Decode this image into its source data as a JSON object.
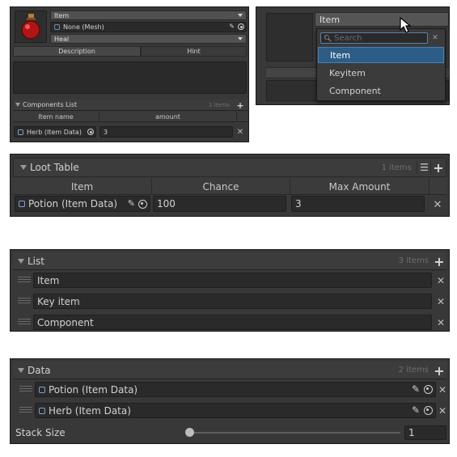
{
  "item_inspector": {
    "type_value": "Item",
    "mesh_value": "None (Mesh)",
    "effect_value": "Heal",
    "tabs": [
      "Description",
      "Hint"
    ],
    "components": {
      "title": "Components List",
      "count": "1 items",
      "headers": [
        "Item name",
        "amount"
      ],
      "row": {
        "item": "Herb (Item Data)",
        "amount": "3"
      }
    }
  },
  "dropdown": {
    "field_value": "Item",
    "search_placeholder": "Search",
    "options": [
      "Item",
      "Keyitem",
      "Component"
    ],
    "selected_index": 0
  },
  "loot_table": {
    "title": "Loot Table",
    "count": "1 items",
    "headers": [
      "Item",
      "Chance",
      "Max Amount"
    ],
    "row": {
      "item": "Potion (Item Data)",
      "chance": "100",
      "max_amount": "3"
    }
  },
  "list": {
    "title": "List",
    "count": "3 items",
    "items": [
      "Item",
      "Key item",
      "Component"
    ]
  },
  "data": {
    "title": "Data",
    "count": "2 items",
    "items": [
      "Potion (Item Data)",
      "Herb (Item Data)"
    ],
    "stack_label": "Stack Size",
    "stack_value": "1",
    "stack_fraction": 0
  },
  "colors": {
    "selection": "#2c5d87",
    "panel": "#383838",
    "field": "#2a2a2a"
  }
}
